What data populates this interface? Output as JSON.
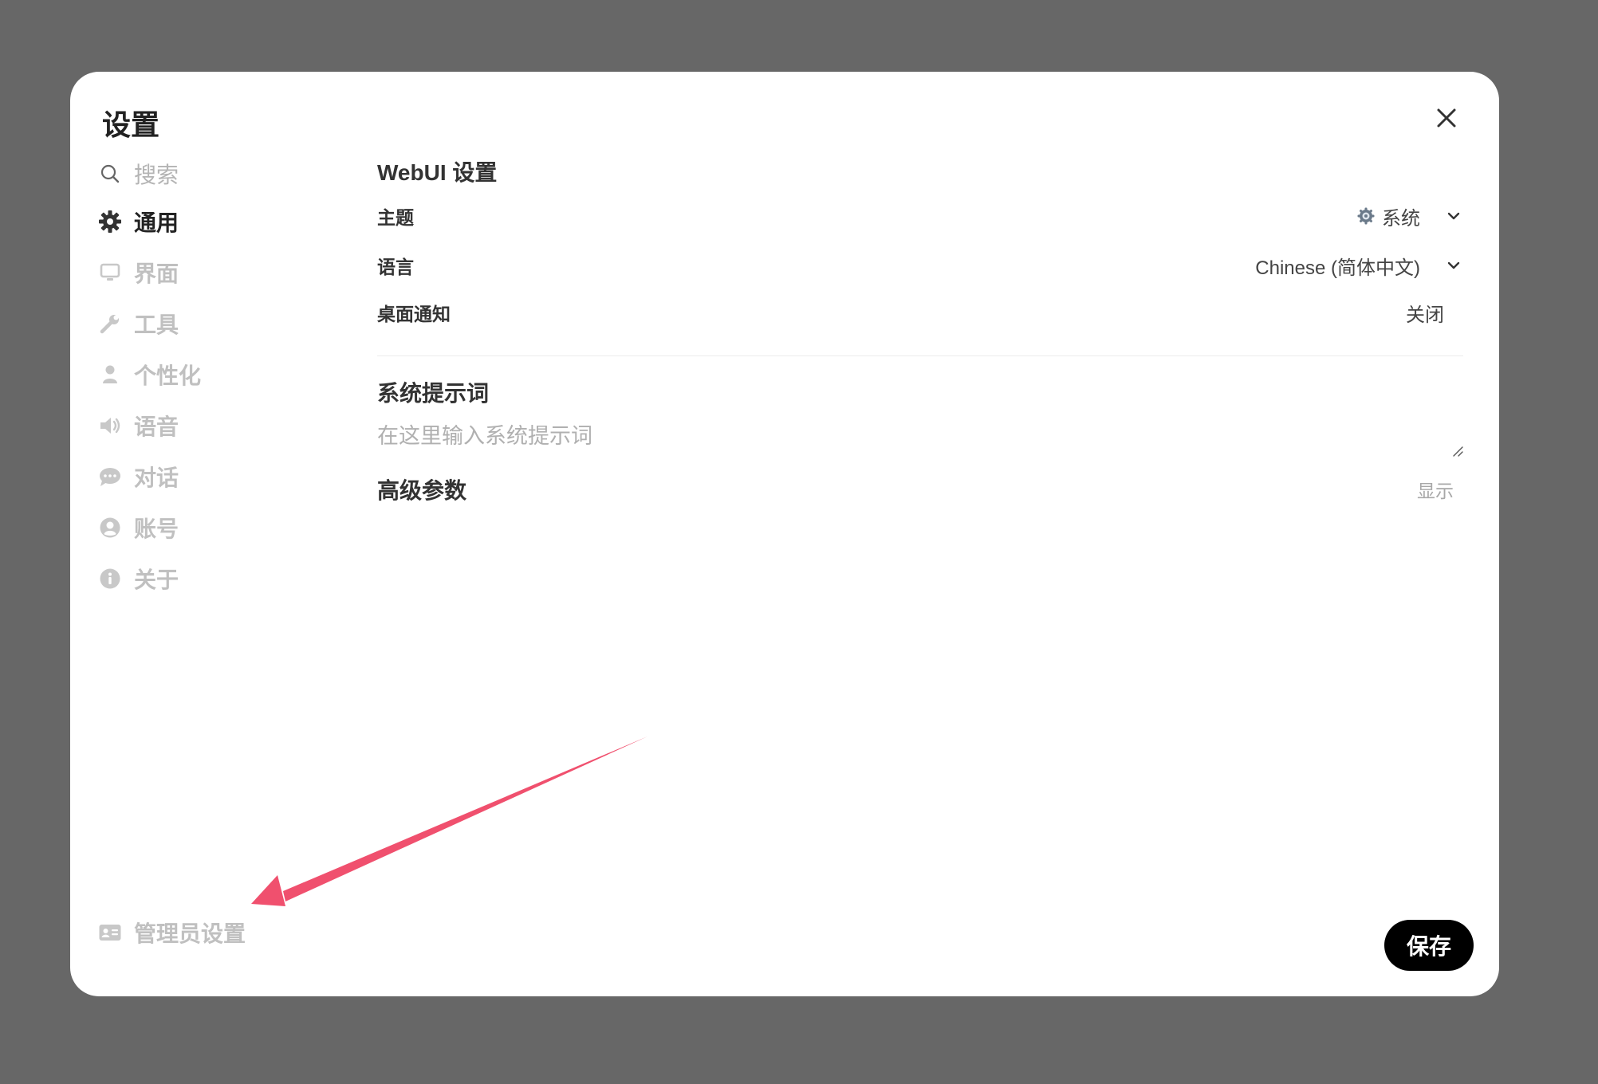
{
  "modal": {
    "title": "设置",
    "close_icon": "close-icon"
  },
  "sidebar": {
    "search_label": "搜索",
    "items": [
      {
        "label": "通用",
        "icon": "gear-icon",
        "active": true
      },
      {
        "label": "界面",
        "icon": "monitor-icon",
        "active": false
      },
      {
        "label": "工具",
        "icon": "wrench-icon",
        "active": false
      },
      {
        "label": "个性化",
        "icon": "user-icon",
        "active": false
      },
      {
        "label": "语音",
        "icon": "speaker-icon",
        "active": false
      },
      {
        "label": "对话",
        "icon": "chat-bubble-icon",
        "active": false
      },
      {
        "label": "账号",
        "icon": "user-circle-icon",
        "active": false
      },
      {
        "label": "关于",
        "icon": "info-icon",
        "active": false
      }
    ],
    "admin_label": "管理员设置",
    "admin_icon": "id-card-icon"
  },
  "main": {
    "webui_title": "WebUI 设置",
    "theme": {
      "label": "主题",
      "value": "系统",
      "icon": "system-gear-icon"
    },
    "language": {
      "label": "语言",
      "value": "Chinese (简体中文)"
    },
    "notifications": {
      "label": "桌面通知",
      "value": "关闭"
    },
    "system_prompt": {
      "title": "系统提示词",
      "placeholder": "在这里输入系统提示词"
    },
    "advanced": {
      "label": "高级参数",
      "toggle": "显示"
    }
  },
  "footer": {
    "save_label": "保存"
  },
  "colors": {
    "backdrop": "#676767",
    "modal_bg": "#ffffff",
    "active_text": "#222222",
    "inactive_text": "#c0c0c0",
    "save_bg": "#000000",
    "annotation_arrow": "#f0506e"
  }
}
